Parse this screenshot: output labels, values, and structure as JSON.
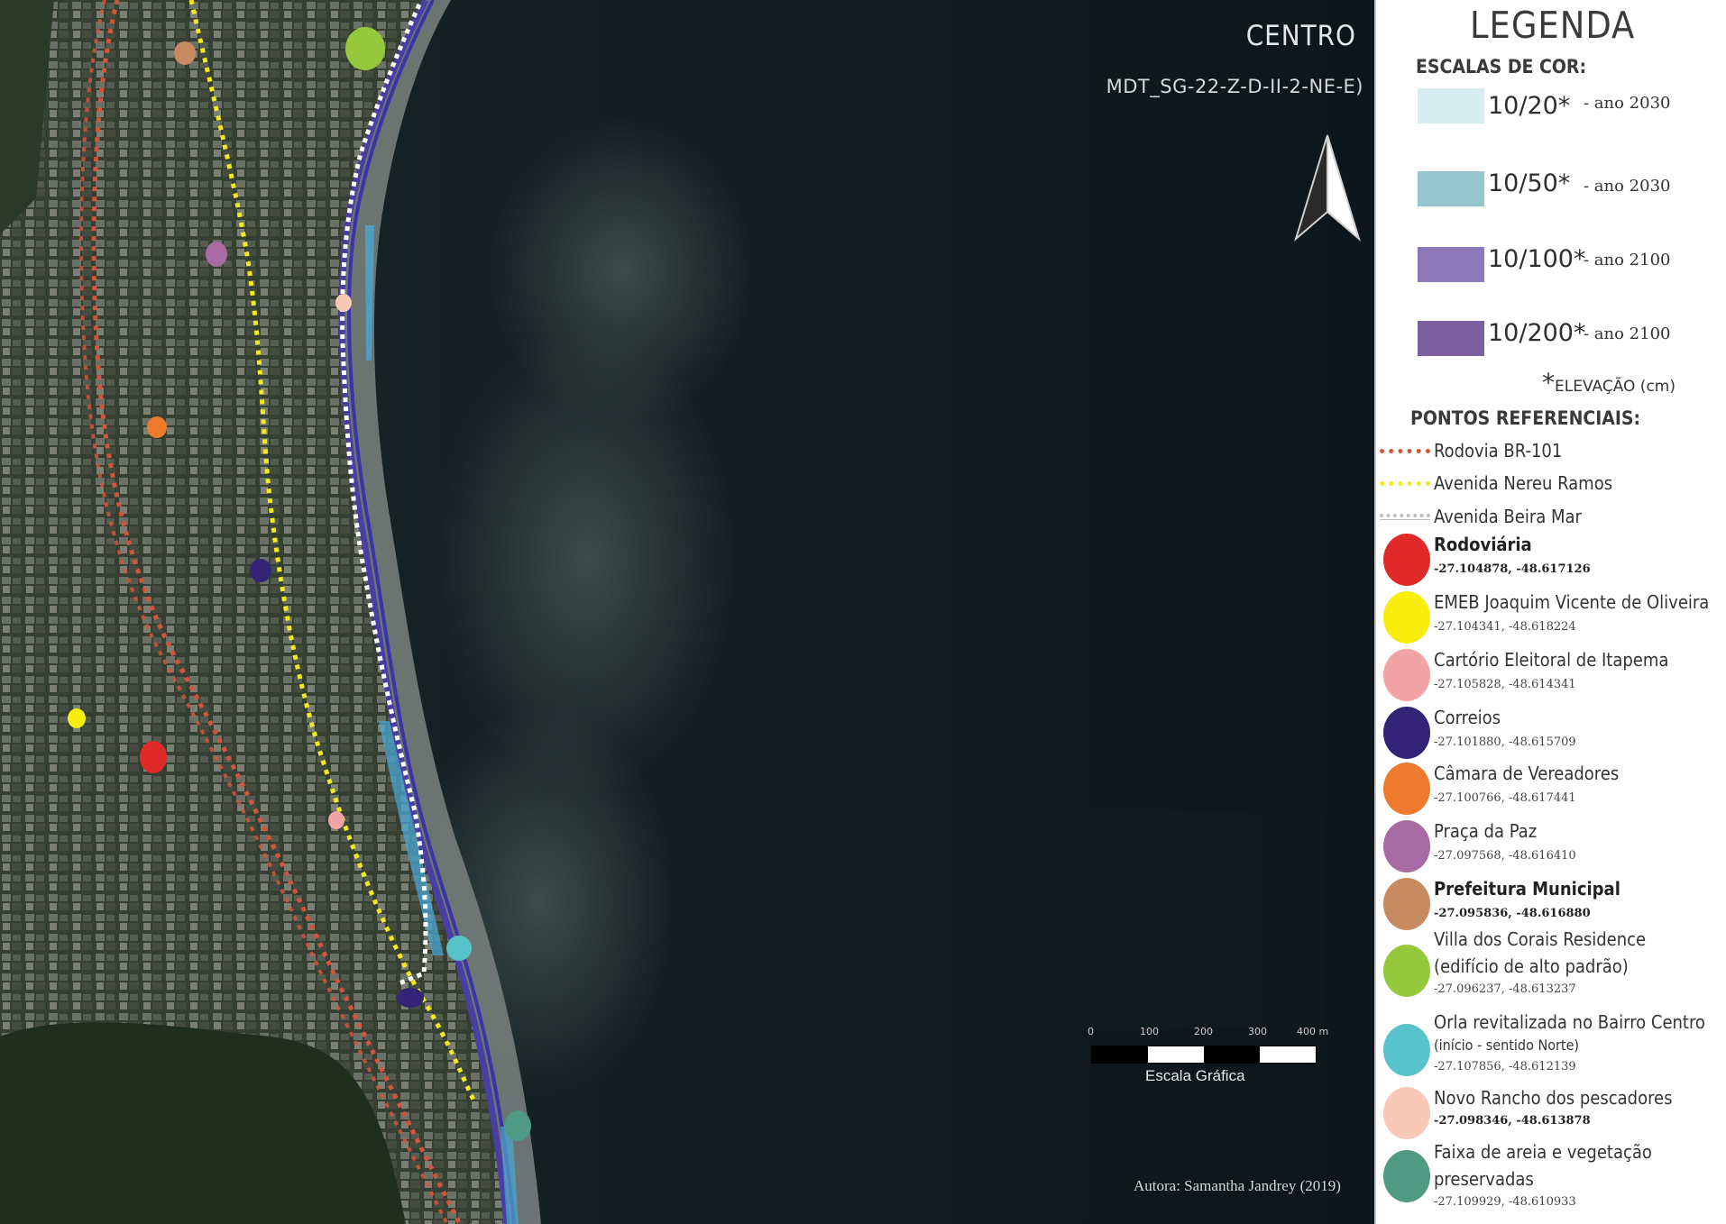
{
  "map": {
    "title": "CENTRO",
    "subtitle": "MDT_SG-22-Z-D-II-2-NE-E)",
    "author": "Autora: Samantha Jandrey (2019)",
    "north_arrow_icon": "north-arrow-icon",
    "scale": {
      "ticks": [
        "0",
        "100",
        "200",
        "300",
        "400 m"
      ],
      "label": "Escala Gráfica"
    }
  },
  "legend": {
    "title": "LEGENDA",
    "color_scales_heading": "ESCALAS DE COR:",
    "color_scales": [
      {
        "label": "10/20*",
        "year": "- ano 2030",
        "color": "#d7ecf1"
      },
      {
        "label": "10/50*",
        "year": "- ano 2030",
        "color": "#97c6cf"
      },
      {
        "label": "10/100*",
        "year": "- ano 2100",
        "color": "#8b78b8"
      },
      {
        "label": "10/200*",
        "year": "- ano 2100",
        "color": "#7b5f9e"
      }
    ],
    "elevation_star": "*",
    "elevation_note": "ELEVAÇÃO (cm)",
    "reference_heading": "PONTOS REFERENCIAIS:",
    "lines": [
      {
        "label": "Rodovia BR-101",
        "color": "#d2553a"
      },
      {
        "label": "Avenida Nereu Ramos",
        "color": "#f2ea1c"
      },
      {
        "label": "Avenida Beira Mar",
        "color": "#bdbdbd"
      }
    ],
    "points": [
      {
        "name": "Rodoviária",
        "coords": "-27.104878, -48.617126",
        "color": "#e02a2a",
        "bold": true
      },
      {
        "name": "EMEB Joaquim Vicente de Oliveira",
        "coords": "-27.104341, -48.618224",
        "color": "#f7ee0e",
        "bold": false
      },
      {
        "name": "Cartório Eleitoral de Itapema",
        "coords": "-27.105828, -48.614341",
        "color": "#f2a3a6",
        "bold": false
      },
      {
        "name": "Correios",
        "coords": "-27.101880, -48.615709",
        "color": "#332477",
        "bold": false
      },
      {
        "name": "Câmara de Vereadores",
        "coords": "-27.100766, -48.617441",
        "color": "#ee7a2e",
        "bold": false
      },
      {
        "name": "Praça da Paz",
        "coords": "-27.097568, -48.616410",
        "color": "#a76aa2",
        "bold": false
      },
      {
        "name": "Prefeitura Municipal",
        "coords": "-27.095836, -48.616880",
        "color": "#c88a60",
        "bold": true
      },
      {
        "name": "Villa dos Corais Residence",
        "name2": "(edifício de alto padrão)",
        "coords": "-27.096237, -48.613237",
        "color": "#95c83a",
        "bold": false
      },
      {
        "name": "Orla revitalizada no Bairro Centro",
        "name2": "(início - sentido Norte)",
        "coords": "-27.107856, -48.612139",
        "color": "#58c3cb",
        "bold": false
      },
      {
        "name": "Novo Rancho dos pescadores",
        "coords": "-27.098346, -48.613878",
        "color": "#f9c8b6",
        "bold": false
      },
      {
        "name": "Faixa de areia e vegetação",
        "name2": "preservadas",
        "coords": "-27.109929, -48.610933",
        "color": "#4f9a82",
        "bold": false
      }
    ]
  }
}
